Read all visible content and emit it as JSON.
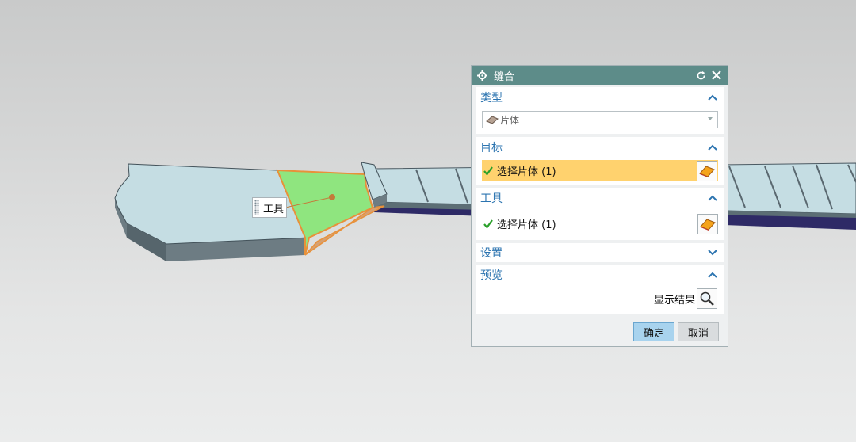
{
  "viewport": {
    "tool_label": "工具"
  },
  "dialog": {
    "title": "缝合",
    "sections": {
      "type": {
        "header": "类型",
        "selected_value": "片体"
      },
      "target": {
        "header": "目标",
        "selection_text": "选择片体 (1)"
      },
      "tool": {
        "header": "工具",
        "selection_text": "选择片体 (1)"
      },
      "settings": {
        "header": "设置"
      },
      "preview": {
        "header": "预览",
        "show_result_label": "显示结果"
      }
    },
    "buttons": {
      "ok": "确定",
      "cancel": "取消"
    }
  },
  "colors": {
    "title_bar": "#5d8c89",
    "section_header_text": "#2c74b0",
    "selected_row": "#ffd26e",
    "ok_button": "#a8d3ee",
    "model_surface": "#c5dde3",
    "selected_face": "#8fe57f",
    "edge_highlight": "#e8913a"
  }
}
